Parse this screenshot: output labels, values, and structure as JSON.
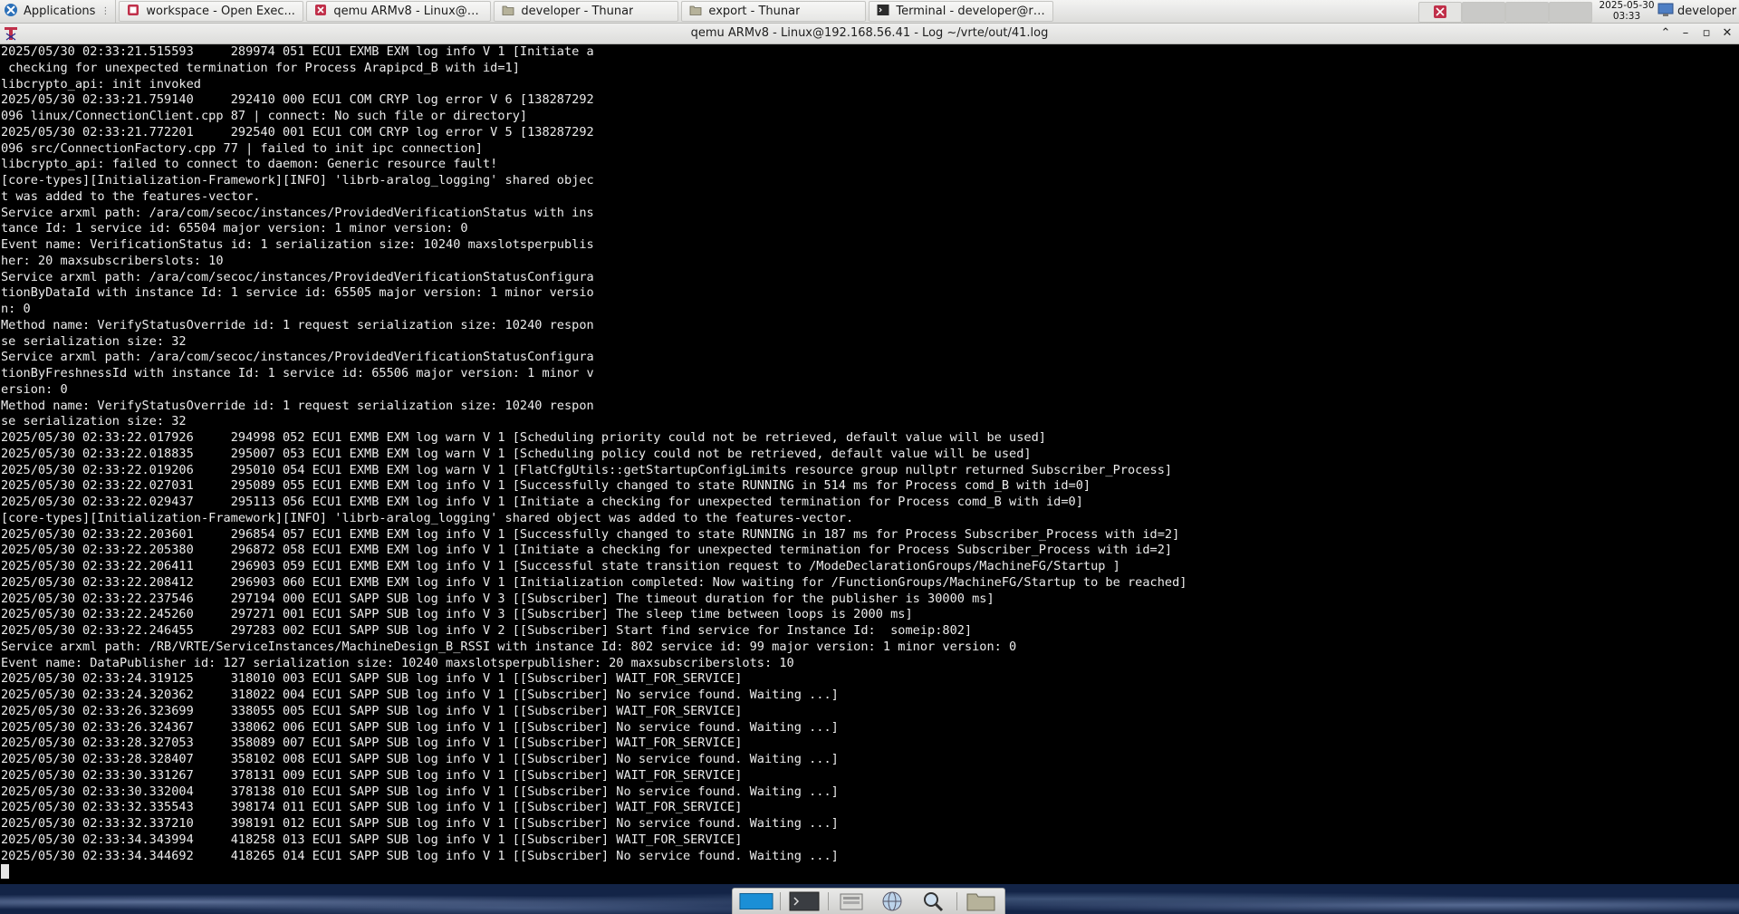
{
  "panel": {
    "applications_label": "Applications",
    "tasks": [
      {
        "label": "workspace - Open Exec...",
        "icon": "app-icon"
      },
      {
        "label": "qemu ARMv8 - Linux@1...",
        "icon": "terminal-app-icon"
      },
      {
        "label": "developer - Thunar",
        "icon": "folder-icon"
      },
      {
        "label": "export - Thunar",
        "icon": "folder-icon"
      },
      {
        "label": "Terminal - developer@rt...",
        "icon": "terminal-icon"
      }
    ],
    "clock_date": "2025-05-30",
    "clock_time": "03:33",
    "user_label": "developer"
  },
  "window": {
    "title": "qemu ARMv8 - Linux@192.168.56.41 - Log ~/vrte/out/41.log"
  },
  "terminal": {
    "lines": [
      "2025/05/30 02:33:21.515593     289974 051 ECU1 EXMB EXM log info V 1 [Initiate a",
      " checking for unexpected termination for Process Arapipcd_B with id=1]",
      "libcrypto_api: init invoked",
      "2025/05/30 02:33:21.759140     292410 000 ECU1 COM CRYP log error V 6 [138287292",
      "096 linux/ConnectionClient.cpp 87 | connect: No such file or directory]",
      "2025/05/30 02:33:21.772201     292540 001 ECU1 COM CRYP log error V 5 [138287292",
      "096 src/ConnectionFactory.cpp 77 | failed to init ipc connection]",
      "libcrypto_api: failed to connect to daemon: Generic resource fault!",
      "[core-types][Initialization-Framework][INFO] 'librb-aralog_logging' shared objec",
      "t was added to the features-vector.",
      "Service arxml path: /ara/com/secoc/instances/ProvidedVerificationStatus with ins",
      "tance Id: 1 service id: 65504 major version: 1 minor version: 0",
      "Event name: VerificationStatus id: 1 serialization size: 10240 maxslotsperpublis",
      "her: 20 maxsubscriberslots: 10",
      "Service arxml path: /ara/com/secoc/instances/ProvidedVerificationStatusConfigura",
      "tionByDataId with instance Id: 1 service id: 65505 major version: 1 minor versio",
      "n: 0",
      "Method name: VerifyStatusOverride id: 1 request serialization size: 10240 respon",
      "se serialization size: 32",
      "Service arxml path: /ara/com/secoc/instances/ProvidedVerificationStatusConfigura",
      "tionByFreshnessId with instance Id: 1 service id: 65506 major version: 1 minor v",
      "ersion: 0",
      "Method name: VerifyStatusOverride id: 1 request serialization size: 10240 respon",
      "se serialization size: 32",
      "2025/05/30 02:33:22.017926     294998 052 ECU1 EXMB EXM log warn V 1 [Scheduling priority could not be retrieved, default value will be used]",
      "2025/05/30 02:33:22.018835     295007 053 ECU1 EXMB EXM log warn V 1 [Scheduling policy could not be retrieved, default value will be used]",
      "2025/05/30 02:33:22.019206     295010 054 ECU1 EXMB EXM log warn V 1 [FlatCfgUtils::getStartupConfigLimits resource group nullptr returned Subscriber_Process]",
      "2025/05/30 02:33:22.027031     295089 055 ECU1 EXMB EXM log info V 1 [Successfully changed to state RUNNING in 514 ms for Process comd_B with id=0]",
      "2025/05/30 02:33:22.029437     295113 056 ECU1 EXMB EXM log info V 1 [Initiate a checking for unexpected termination for Process comd_B with id=0]",
      "[core-types][Initialization-Framework][INFO] 'librb-aralog_logging' shared object was added to the features-vector.",
      "2025/05/30 02:33:22.203601     296854 057 ECU1 EXMB EXM log info V 1 [Successfully changed to state RUNNING in 187 ms for Process Subscriber_Process with id=2]",
      "2025/05/30 02:33:22.205380     296872 058 ECU1 EXMB EXM log info V 1 [Initiate a checking for unexpected termination for Process Subscriber_Process with id=2]",
      "2025/05/30 02:33:22.206411     296903 059 ECU1 EXMB EXM log info V 1 [Successful state transition request to /ModeDeclarationGroups/MachineFG/Startup ]",
      "2025/05/30 02:33:22.208412     296903 060 ECU1 EXMB EXM log info V 1 [Initialization completed: Now waiting for /FunctionGroups/MachineFG/Startup to be reached]",
      "2025/05/30 02:33:22.237546     297194 000 ECU1 SAPP SUB log info V 3 [[Subscriber] The timeout duration for the publisher is 30000 ms]",
      "2025/05/30 02:33:22.245260     297271 001 ECU1 SAPP SUB log info V 3 [[Subscriber] The sleep time between loops is 2000 ms]",
      "2025/05/30 02:33:22.246455     297283 002 ECU1 SAPP SUB log info V 2 [[Subscriber] Start find service for Instance Id:  someip:802]",
      "Service arxml path: /RB/VRTE/ServiceInstances/MachineDesign_B_RSSI with instance Id: 802 service id: 99 major version: 1 minor version: 0",
      "Event name: DataPublisher id: 127 serialization size: 10240 maxslotsperpublisher: 20 maxsubscriberslots: 10",
      "2025/05/30 02:33:24.319125     318010 003 ECU1 SAPP SUB log info V 1 [[Subscriber] WAIT_FOR_SERVICE]",
      "2025/05/30 02:33:24.320362     318022 004 ECU1 SAPP SUB log info V 1 [[Subscriber] No service found. Waiting ...]",
      "2025/05/30 02:33:26.323699     338055 005 ECU1 SAPP SUB log info V 1 [[Subscriber] WAIT_FOR_SERVICE]",
      "2025/05/30 02:33:26.324367     338062 006 ECU1 SAPP SUB log info V 1 [[Subscriber] No service found. Waiting ...]",
      "2025/05/30 02:33:28.327053     358089 007 ECU1 SAPP SUB log info V 1 [[Subscriber] WAIT_FOR_SERVICE]",
      "2025/05/30 02:33:28.328407     358102 008 ECU1 SAPP SUB log info V 1 [[Subscriber] No service found. Waiting ...]",
      "2025/05/30 02:33:30.331267     378131 009 ECU1 SAPP SUB log info V 1 [[Subscriber] WAIT_FOR_SERVICE]",
      "2025/05/30 02:33:30.332004     378138 010 ECU1 SAPP SUB log info V 1 [[Subscriber] No service found. Waiting ...]",
      "2025/05/30 02:33:32.335543     398174 011 ECU1 SAPP SUB log info V 1 [[Subscriber] WAIT_FOR_SERVICE]",
      "2025/05/30 02:33:32.337210     398191 012 ECU1 SAPP SUB log info V 1 [[Subscriber] No service found. Waiting ...]",
      "2025/05/30 02:33:34.343994     418258 013 ECU1 SAPP SUB log info V 1 [[Subscriber] WAIT_FOR_SERVICE]",
      "2025/05/30 02:33:34.344692     418265 014 ECU1 SAPP SUB log info V 1 [[Subscriber] No service found. Waiting ...]"
    ]
  },
  "dock": {
    "items": [
      "show-desktop-icon",
      "terminal-icon",
      "file-manager-icon",
      "web-browser-icon",
      "search-icon",
      "folder-icon"
    ]
  }
}
